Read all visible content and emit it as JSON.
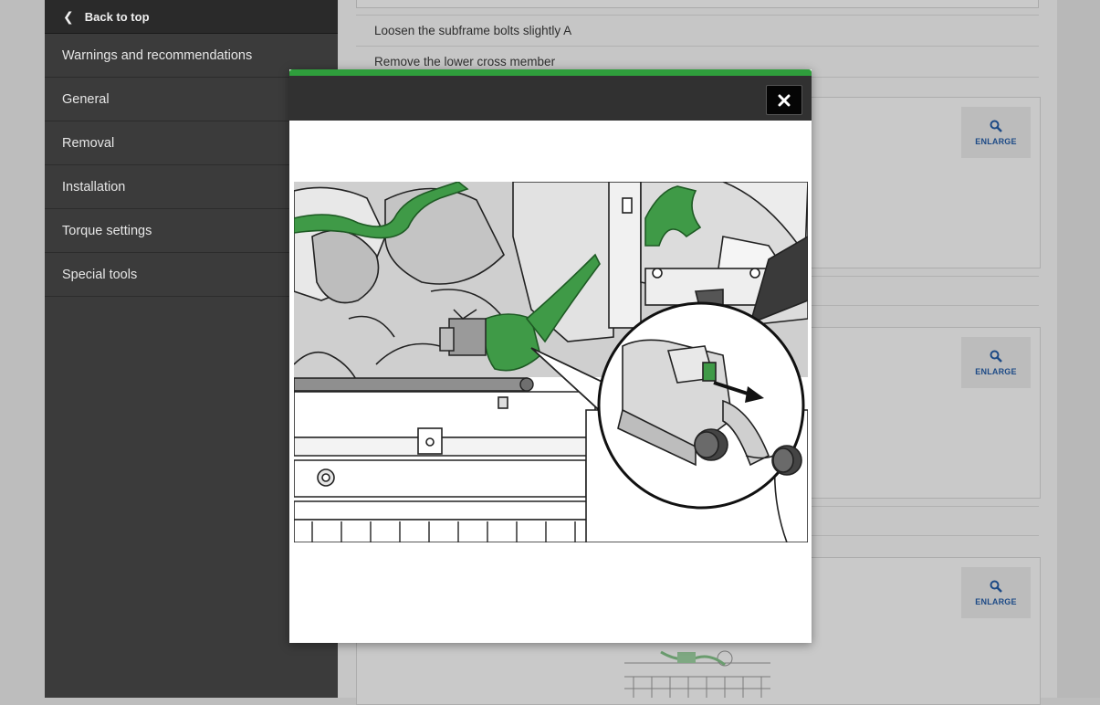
{
  "sidebar": {
    "back_label": "Back to top",
    "items": [
      {
        "label": "Warnings and recommendations"
      },
      {
        "label": "General"
      },
      {
        "label": "Removal"
      },
      {
        "label": "Installation"
      },
      {
        "label": "Torque settings"
      },
      {
        "label": "Special tools"
      }
    ]
  },
  "steps": [
    {
      "text": "Loosen the subframe bolts slightly A"
    },
    {
      "text": "Remove the lower cross member"
    }
  ],
  "figures": [
    {
      "enlarge_label": "ENLARGE"
    },
    {
      "enlarge_label": "ENLARGE"
    },
    {
      "enlarge_label": "ENLARGE"
    }
  ],
  "modal": {
    "accent_color": "#2f9e3c",
    "close_icon": "close-icon"
  },
  "colors": {
    "sidebar_bg": "#3b3b3b",
    "highlight_green": "#3f9a47",
    "enlarge_text": "#1d4a86"
  }
}
